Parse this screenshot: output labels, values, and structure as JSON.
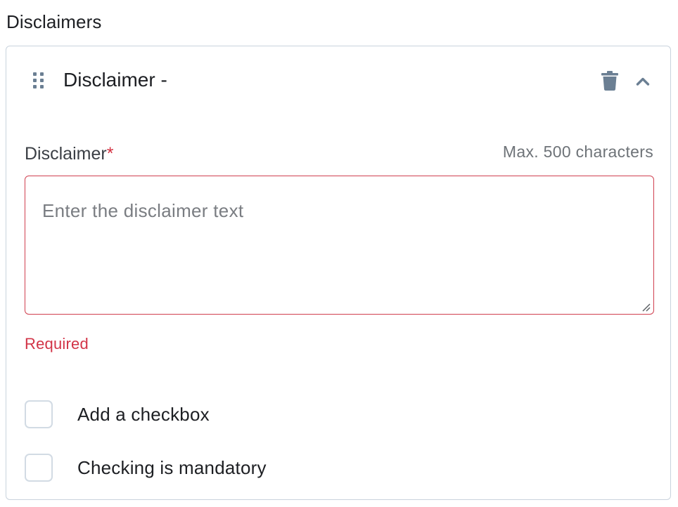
{
  "section": {
    "title": "Disclaimers"
  },
  "card": {
    "title": "Disclaimer -",
    "icons": {
      "drag": "drag-handle-icon",
      "delete": "trash-icon",
      "collapse": "chevron-up-icon"
    }
  },
  "field": {
    "label": "Disclaimer",
    "required_marker": "*",
    "hint": "Max. 500 characters",
    "value": "",
    "placeholder": "Enter the disclaimer text",
    "error": "Required"
  },
  "options": {
    "add_checkbox": {
      "label": "Add a checkbox",
      "checked": false
    },
    "mandatory": {
      "label": "Checking is mandatory",
      "checked": false
    }
  },
  "colors": {
    "border": "#c9d3dd",
    "error": "#d23447",
    "icon": "#6b7f93",
    "checkbox_border": "#d2dbe4"
  }
}
